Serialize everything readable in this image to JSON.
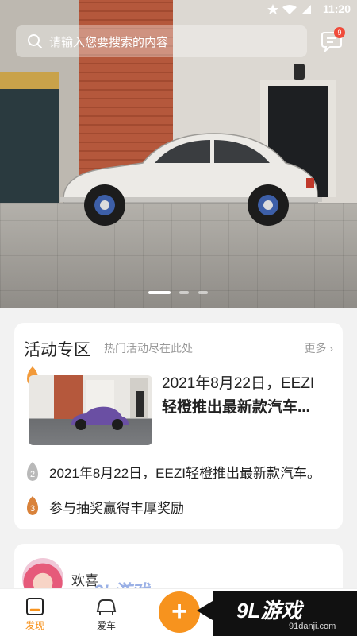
{
  "status_bar": {
    "time": "11:20"
  },
  "search": {
    "placeholder": "请输入您要搜索的内容"
  },
  "messages": {
    "badge_count": "9"
  },
  "banner": {
    "slides_total": 3,
    "active_slide": 1
  },
  "activity": {
    "title": "活动专区",
    "subtitle": "热门活动尽在此处",
    "more_label": "更多",
    "items": [
      {
        "rank": "1",
        "text_line1": "2021年8月22日，EEZI",
        "text_line2": "轻橙推出最新款汽车..."
      },
      {
        "rank": "2",
        "text": "2021年8月22日，EEZI轻橙推出最新款汽车。"
      },
      {
        "rank": "3",
        "text": "参与抽奖赢得丰厚奖励"
      }
    ]
  },
  "feed": {
    "welcome_text": "欢喜"
  },
  "bottom_nav": {
    "items": [
      {
        "label": "发现",
        "active": true
      },
      {
        "label": "爱车",
        "active": false
      }
    ],
    "fab_label": "+"
  },
  "watermark": {
    "logo_text": "9L游戏",
    "site": "91danji.com"
  },
  "colors": {
    "accent": "#f7931e",
    "badge": "#f04b3a"
  }
}
